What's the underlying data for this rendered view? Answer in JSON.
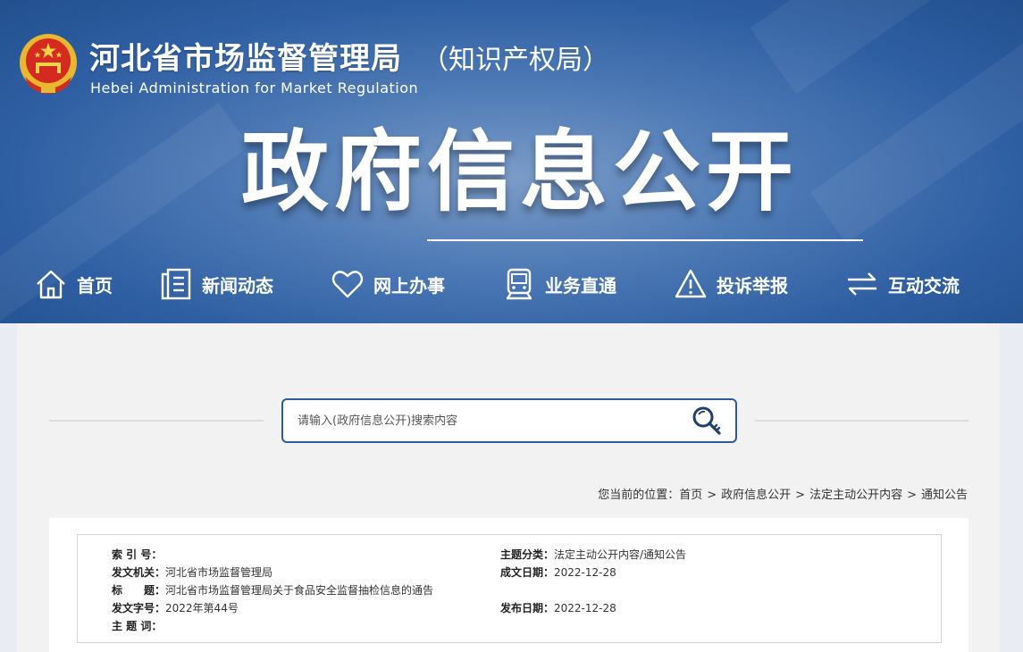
{
  "header": {
    "title": "河北省市场监督管理局",
    "title_sub": "（知识产权局）",
    "title_en": "Hebei Administration for Market Regulation",
    "hero": "政府信息公开",
    "brand_color": "#2f5fa3"
  },
  "nav": {
    "items": [
      {
        "label": "首页",
        "icon": "home-icon"
      },
      {
        "label": "新闻动态",
        "icon": "document-icon"
      },
      {
        "label": "网上办事",
        "icon": "heart-icon"
      },
      {
        "label": "业务直通",
        "icon": "train-icon"
      },
      {
        "label": "投诉举报",
        "icon": "warning-icon"
      },
      {
        "label": "互动交流",
        "icon": "exchange-icon"
      }
    ]
  },
  "search": {
    "placeholder": "请输入(政府信息公开)搜索内容",
    "value": "",
    "icon": "search-key-icon"
  },
  "breadcrumb": {
    "prefix": "您当前的位置：",
    "items": [
      "首页",
      "政府信息公开",
      "法定主动公开内容",
      "通知公告"
    ],
    "separator": ">"
  },
  "meta": {
    "index_no": {
      "label": "索 引 号：",
      "value": ""
    },
    "category": {
      "label": "主题分类：",
      "value": "法定主动公开内容/通知公告"
    },
    "issuer": {
      "label": "发文机关：",
      "value": "河北省市场监督管理局"
    },
    "created": {
      "label": "成文日期：",
      "value": "2022-12-28"
    },
    "title": {
      "label": "标　　题：",
      "value": "河北省市场监督管理局关于食品安全监督抽检信息的通告"
    },
    "doc_no": {
      "label": "发文字号：",
      "value": "2022年第44号"
    },
    "published": {
      "label": "发布日期：",
      "value": "2022-12-28"
    },
    "keywords": {
      "label": "主 题 词：",
      "value": ""
    }
  }
}
